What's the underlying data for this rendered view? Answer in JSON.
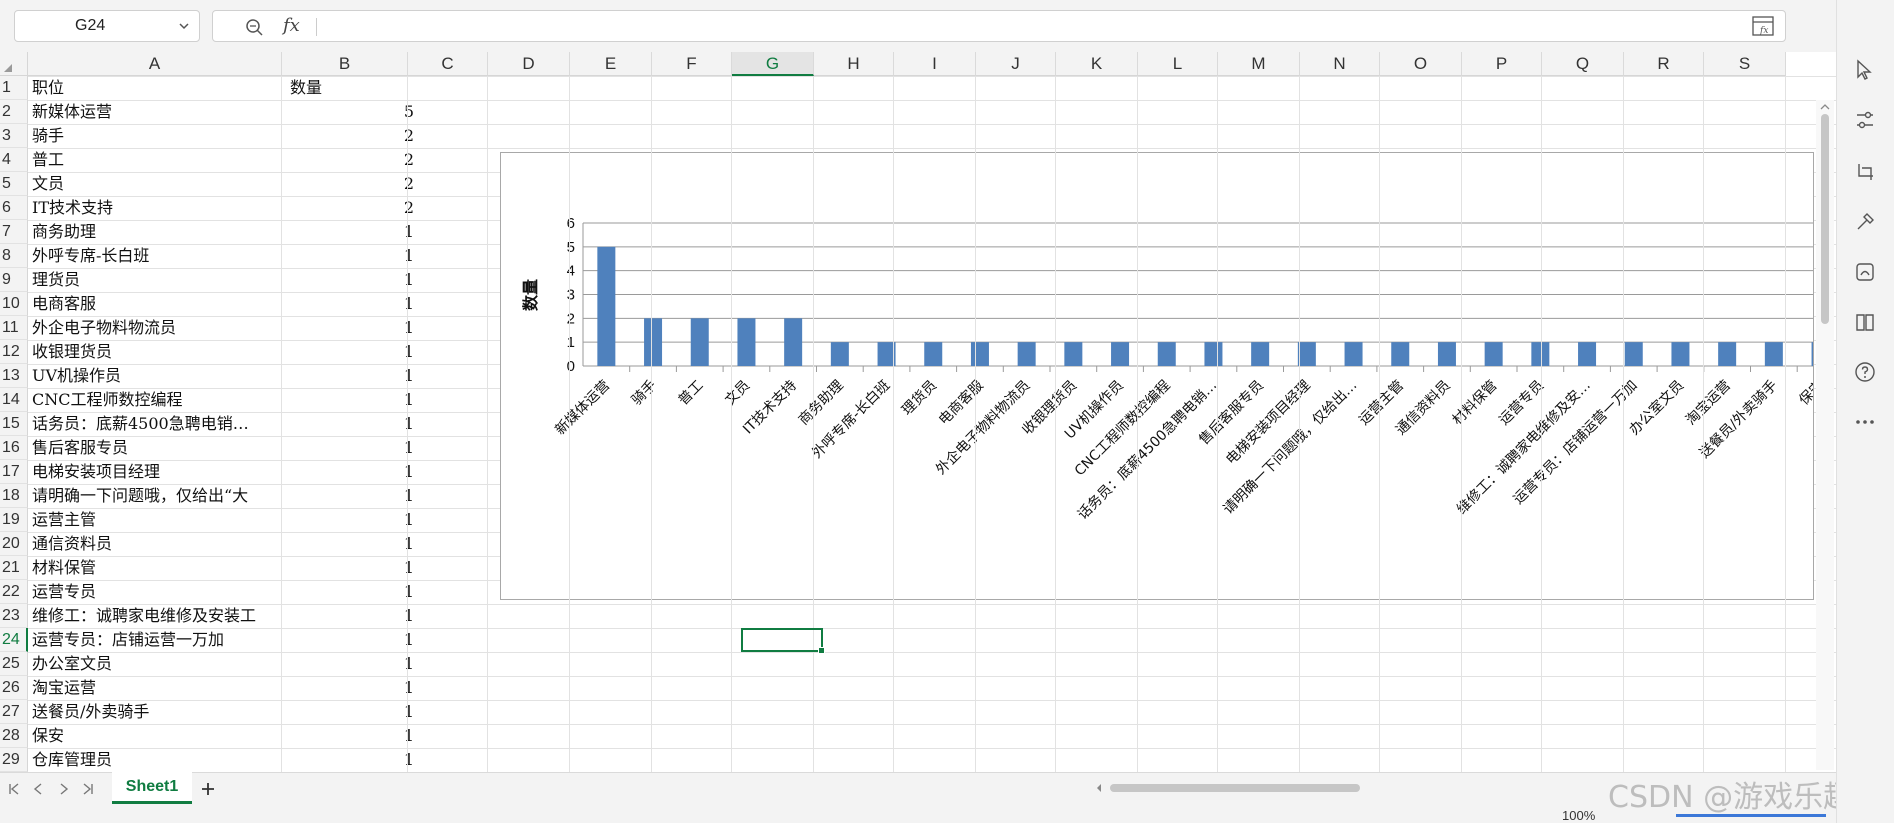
{
  "name_box": {
    "value": "G24"
  },
  "formula_bar": {
    "fx_label": "fx",
    "value": ""
  },
  "columns": [
    "A",
    "B",
    "C",
    "D",
    "E",
    "F",
    "G",
    "H",
    "I",
    "J",
    "K",
    "L",
    "M",
    "N",
    "O",
    "P",
    "Q",
    "R",
    "S"
  ],
  "selected_column": "G",
  "selected_row": 24,
  "rows": [
    {
      "n": "1",
      "a": "职位",
      "b": "数量"
    },
    {
      "n": "2",
      "a": "新媒体运营",
      "b": "5"
    },
    {
      "n": "3",
      "a": "骑手",
      "b": "2"
    },
    {
      "n": "4",
      "a": "普工",
      "b": "2"
    },
    {
      "n": "5",
      "a": "文员",
      "b": "2"
    },
    {
      "n": "6",
      "a": "IT技术支持",
      "b": "2"
    },
    {
      "n": "7",
      "a": "商务助理",
      "b": "1"
    },
    {
      "n": "8",
      "a": "外呼专席-长白班",
      "b": "1"
    },
    {
      "n": "9",
      "a": "理货员",
      "b": "1"
    },
    {
      "n": "10",
      "a": "电商客服",
      "b": "1"
    },
    {
      "n": "11",
      "a": "外企电子物料物流员",
      "b": "1"
    },
    {
      "n": "12",
      "a": "收银理货员",
      "b": "1"
    },
    {
      "n": "13",
      "a": "UV机操作员",
      "b": "1"
    },
    {
      "n": "14",
      "a": "CNC工程师数控编程",
      "b": "1"
    },
    {
      "n": "15",
      "a": "话务员：底薪4500急聘电销…",
      "b": "1"
    },
    {
      "n": "16",
      "a": "售后客服专员",
      "b": "1"
    },
    {
      "n": "17",
      "a": "电梯安装项目经理",
      "b": "1"
    },
    {
      "n": "18",
      "a": "请明确一下问题哦，仅给出“大",
      "b": "1"
    },
    {
      "n": "19",
      "a": "运营主管",
      "b": "1"
    },
    {
      "n": "20",
      "a": "通信资料员",
      "b": "1"
    },
    {
      "n": "21",
      "a": "材料保管",
      "b": "1"
    },
    {
      "n": "22",
      "a": "运营专员",
      "b": "1"
    },
    {
      "n": "23",
      "a": "维修工：诚聘家电维修及安装工",
      "b": "1"
    },
    {
      "n": "24",
      "a": "运营专员：店铺运营一万加",
      "b": "1"
    },
    {
      "n": "25",
      "a": "办公室文员",
      "b": "1"
    },
    {
      "n": "26",
      "a": "淘宝运营",
      "b": "1"
    },
    {
      "n": "27",
      "a": "送餐员/外卖骑手",
      "b": "1"
    },
    {
      "n": "28",
      "a": "保安",
      "b": "1"
    },
    {
      "n": "29",
      "a": "仓库管理员",
      "b": "1"
    }
  ],
  "chart_data": {
    "type": "bar",
    "title": "",
    "xlabel": "",
    "ylabel": "数量",
    "ylim": [
      0,
      6
    ],
    "yticks": [
      "0",
      "1",
      "2",
      "3",
      "4",
      "5",
      "6"
    ],
    "grid": true,
    "legend": "none",
    "bar_color": "#4f81bd",
    "categories": [
      "新媒体运营",
      "骑手",
      "普工",
      "文员",
      "IT技术支持",
      "商务助理",
      "外呼专席-长白班",
      "理货员",
      "电商客服",
      "外企电子物料物流员",
      "收银理货员",
      "UV机操作员",
      "CNC工程师数控编程",
      "话务员：底薪4500急聘电销…",
      "售后客服专员",
      "电梯安装项目经理",
      "请明确一下问题哦，仅给出…",
      "运营主管",
      "通信资料员",
      "材料保管",
      "运营专员",
      "维修工：诚聘家电维修及安…",
      "运营专员：店铺运营一万加",
      "办公室文员",
      "淘宝运营",
      "送餐员/外卖骑手",
      "保安"
    ],
    "values": [
      5,
      2,
      2,
      2,
      2,
      1,
      1,
      1,
      1,
      1,
      1,
      1,
      1,
      1,
      1,
      1,
      1,
      1,
      1,
      1,
      1,
      1,
      1,
      1,
      1,
      1,
      1
    ]
  },
  "sheet_tabs": [
    {
      "label": "Sheet1",
      "active": true
    }
  ],
  "status": {
    "zoom": "100%"
  },
  "watermark": "CSDN @游戏乐趣",
  "accent_color": "#107c41"
}
